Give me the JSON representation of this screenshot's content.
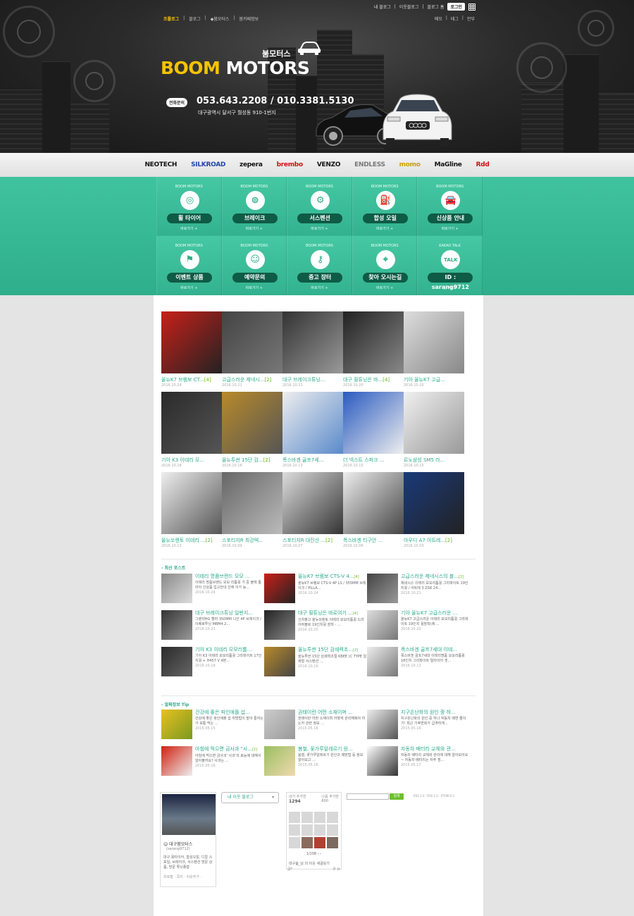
{
  "header": {
    "top_links": [
      "내 블로그",
      "이웃블로그",
      "블로그 홈"
    ],
    "login": "로그인",
    "nav": [
      "프롤로그",
      "블로그",
      "◆붐모터스",
      "붐카페정보"
    ],
    "nav_active": 0,
    "sub_links": [
      "메모",
      "태그",
      "안부"
    ],
    "logo_kor": "붐모터스",
    "logo_boom": "BOOM",
    "logo_motors": "MOTORS",
    "tel_label": "전화문의",
    "tel": "053.643.2208 / 010.3381.5130",
    "address": "대구광역시 달서구 월성동 910-1번지"
  },
  "brands": [
    {
      "name": "NEOTECH",
      "color": "#111111"
    },
    {
      "name": "SILKROAD",
      "color": "#2244aa"
    },
    {
      "name": "zepera",
      "color": "#111111"
    },
    {
      "name": "brembo",
      "color": "#cc1111"
    },
    {
      "name": "VENZO",
      "color": "#111111"
    },
    {
      "name": "ENDLESS",
      "color": "#777777"
    },
    {
      "name": "momo",
      "color": "#c8a000"
    },
    {
      "name": "MaGline",
      "color": "#111111"
    },
    {
      "name": "Rdd",
      "color": "#cc1111"
    }
  ],
  "menu": {
    "row1": [
      {
        "sub": "BOOM MOTORS",
        "label": "휠 타이어",
        "more": "바로가기 +",
        "icon": "wheel-icon",
        "glyph": "◎"
      },
      {
        "sub": "BOOM MOTORS",
        "label": "브레이크",
        "more": "바로가기 +",
        "icon": "brake-disc-icon",
        "glyph": "⊚"
      },
      {
        "sub": "BOOM MOTORS",
        "label": "서스펜션",
        "more": "바로가기 +",
        "icon": "suspension-icon",
        "glyph": "⚙"
      },
      {
        "sub": "BOOM MOTORS",
        "label": "합성 오일",
        "more": "바로가기 +",
        "icon": "oil-can-icon",
        "glyph": "⛽"
      },
      {
        "sub": "BOOM MOTORS",
        "label": "신상품 안내",
        "more": "바로가기 +",
        "icon": "car-lift-icon",
        "glyph": "🚘"
      }
    ],
    "row2": [
      {
        "sub": "BOOM MOTORS",
        "label": "이벤트 상품",
        "more": "바로가기 +",
        "icon": "checkered-flag-icon",
        "glyph": "⚑"
      },
      {
        "sub": "BOOM MOTORS",
        "label": "예약문의",
        "more": "바로가기 +",
        "icon": "chat-person-icon",
        "glyph": "☺"
      },
      {
        "sub": "BOOM MOTORS",
        "label": "중고 장터",
        "more": "바로가기 +",
        "icon": "car-key-icon",
        "glyph": "⚷"
      },
      {
        "sub": "BOOM MOTORS",
        "label": "찾아 오시는길",
        "more": "바로가기 +",
        "icon": "location-pin-icon",
        "glyph": "⌖"
      },
      {
        "sub": "KAKAO TALK",
        "label": "ID : sarang9712",
        "more": "친구추가",
        "icon": "kakao-talk-icon",
        "glyph": "TALK"
      }
    ]
  },
  "thumbs": [
    {
      "title": "올뉴K7 브렘보 CT...",
      "count": "[4]",
      "date": "2016.10.24",
      "c1": "#c8201a",
      "c2": "#222222"
    },
    {
      "title": "고급스러운 제네시...",
      "count": "[2]",
      "date": "2016.10.21",
      "c1": "#444444",
      "c2": "#777777"
    },
    {
      "title": "대구 브레이크튜닝...",
      "count": "",
      "date": "2016.10.21",
      "c1": "#333333",
      "c2": "#999999"
    },
    {
      "title": "대구 휠튜닝은 바...",
      "count": "[4]",
      "date": "2016.10.20",
      "c1": "#222222",
      "c2": "#888888"
    },
    {
      "title": "기아 올뉴K7 고급...",
      "count": "",
      "date": "2016.10.20",
      "c1": "#dddddd",
      "c2": "#888888"
    },
    {
      "title": "기아 K3 이테리 모...",
      "count": "",
      "date": "2016.10.18",
      "c1": "#2a2a2a",
      "c2": "#555555"
    },
    {
      "title": "올뉴투싼 15단 감...",
      "count": "[2]",
      "date": "2016.10.16",
      "c1": "#b88a2a",
      "c2": "#555555"
    },
    {
      "title": "폭스바겐 골프7세...",
      "count": "",
      "date": "2016.10.13",
      "c1": "#eeeeee",
      "c2": "#5a8acb"
    },
    {
      "title": "더 넥스트 스파크 ...",
      "count": "",
      "date": "2016.10.15",
      "c1": "#2a5ac0",
      "c2": "#eeeeee"
    },
    {
      "title": "르노삼성 SM5 라...",
      "count": "",
      "date": "2016.10.15",
      "c1": "#f0f0f0",
      "c2": "#999999"
    },
    {
      "title": "올뉴쏘렌토 이테리 ...",
      "count": "[2]",
      "date": "2016.10.13",
      "c1": "#eeeeee",
      "c2": "#555555"
    },
    {
      "title": "스포티지R 최강텍...",
      "count": "",
      "date": "2016.10.09",
      "c1": "#666666",
      "c2": "#bbbbbb"
    },
    {
      "title": "스포티지R 대진산 ...",
      "count": "[2]",
      "date": "2016.10.07",
      "c1": "#dddddd",
      "c2": "#333333"
    },
    {
      "title": "폭스바겐 티구안 ...",
      "count": "",
      "date": "2016.10.06",
      "c1": "#eeeeee",
      "c2": "#444444"
    },
    {
      "title": "아우디 A7 아트레...",
      "count": "[2]",
      "date": "2016.10.03",
      "c1": "#1a3a7a",
      "c2": "#222222"
    }
  ],
  "recent": {
    "title": "- 최신 포스트",
    "posts": [
      {
        "title": "이테리 명품브랜드 모모 ...",
        "count": "",
        "desc": "이테리 명품브랜드 모모 리튬휠 가 중 블랙 톱라이 신상품 입고안내 산에 이가 능...",
        "date": "2016.10.24",
        "c1": "#888888",
        "c2": "#dddddd"
      },
      {
        "title": "올뉴K7 브렘보 CTS-V 4...",
        "count": "[4]",
        "desc": "올뉴K7 브렘보 CTS-V 4P LS / 355MM 브레이크 / PILLA...",
        "date": "2016.10.24",
        "c1": "#c8201a",
        "c2": "#222222"
      },
      {
        "title": "고급스러운 제네시스의 블...",
        "count": "[2]",
        "desc": "제네시스 이테리 모모리튬휠 그라파이트 19인치휠 / 아트레 3 ZSR 24...",
        "date": "2016.10.21",
        "c1": "#444444",
        "c2": "#999999"
      },
      {
        "title": "대구 브레이크튜닝 일번지...",
        "count": "",
        "desc": "그랜저HG 헬라 350MM 나선 4P 브레이크 / 이베로투닝 M8M4 2...",
        "date": "2016.10.21",
        "c1": "#333333",
        "c2": "#999999"
      },
      {
        "title": "대구 휠튜닝은 바로여기 ...",
        "count": "[4]",
        "desc": "신차출고 올뉴쏘렌토 이테리 모모리튬휠 드라이버블로 19인치휠 장착 - ...",
        "date": "2016.10.20",
        "c1": "#222222",
        "c2": "#888888"
      },
      {
        "title": "기아 올뉴K7 고급스러운 ...",
        "count": "",
        "desc": "올뉴K7 고급스러운 이테리 모모리튬휠 그라파이트 19인치 휠장착(제 ...",
        "date": "2016.10.20",
        "c1": "#dddddd",
        "c2": "#777777"
      },
      {
        "title": "기아 K3 이테리 모모리튬...",
        "count": "",
        "desc": "기아 K3 이테리 모모리튬휠 그라파이트 17인치휠 + H457 V 4본...",
        "date": "2016.10.18",
        "c1": "#2a2a2a",
        "c2": "#666666"
      },
      {
        "title": "올뉴투싼 15단 감쇄력조...",
        "count": "[2]",
        "desc": "올뉴투싼 15단 감쇄력조절 KBEE (C TYPE 일체형 서스펜션 ...",
        "date": "2016.10.16",
        "c1": "#b88a2a",
        "c2": "#444444"
      },
      {
        "title": "폭스바겐 골프7세대 이테...",
        "count": "",
        "desc": "폭스바겐 골프7세대 이테리명품 모모리튬휠 18인치 그라파이트 틸타이어 셋...",
        "date": "2016.10.13",
        "c1": "#eeeeee",
        "c2": "#777777"
      }
    ]
  },
  "tips": {
    "title": "- 알짜정보 Tip",
    "posts": [
      {
        "title": "건강에 좋은 파인애플 섭...",
        "count": "",
        "desc": "건강에 좋은 파인애플 섭 취방법이 발아 통하는가 보통 먹는 ...",
        "date": "2015.05.15",
        "c1": "#e8c020",
        "c2": "#7a9a20"
      },
      {
        "title": "권태이란 어떤 소재이며 ...",
        "count": "",
        "desc": "권태이란 어떤 소재이며 어떻게 관리해줘야 하는지 관련 정보 ...",
        "date": "2015.05.16",
        "c1": "#cccccc",
        "c2": "#999999"
      },
      {
        "title": "지구온난화의 원인 중 하...",
        "count": "",
        "desc": "지구온난화의 원인 중 하나 자동차 매연 줄이기! 최근 기후변화가 급격하게...",
        "date": "2015.05.16",
        "c1": "#eeeeee",
        "c2": "#555555"
      },
      {
        "title": "아침에 먹으면 금사과 \"사...",
        "count": "[2]",
        "desc": "아침에 먹으면 금사과 '사과'의 효능에 대해서 알아볼까요? 사과는 ...",
        "date": "2015.05.16",
        "c1": "#d02010",
        "c2": "#eeeeee"
      },
      {
        "title": "봄철, 꽃가루알레르기 원...",
        "count": "",
        "desc": "봄철, 꽃가루알레르기 원인과 예방법 등 정보 알아보고 ...",
        "date": "2015.05.16",
        "c1": "#9ac060",
        "c2": "#f0d8b0"
      },
      {
        "title": "자동차 배터리 교체와 관...",
        "count": "",
        "desc": "자동차 배터리 교체와 관리에 대해 알아보아요 ~ 자동차 배터리는 자주 점...",
        "date": "2015.05.17",
        "c1": "#ffffff",
        "c2": "#333333"
      }
    ]
  },
  "profile": {
    "name": "대구붐모터스",
    "id": "(sarang9712)",
    "desc": "대구 휠타이어, 합성오일, 디칼 스포일, 브레이크, 서스펜션 방문 상품, 방문 튜닝종합",
    "links": "프로필 · 쪽지 · 이웃추가 ·"
  },
  "widgets": {
    "dropdown": "내 이웃 블로그",
    "neighbor_header_left": "내가 추가한",
    "neighbor_count": "1294",
    "neighbor_header_right": "나를 추가한",
    "neighbor_count2": "800",
    "pager": "1/108",
    "neighbor_foot": "대구붐_님 의 이웃 새글보기",
    "bottom_left": "글*",
    "bottom_right": "우 쓰",
    "search_btn": "검색",
    "rss": "RSS 2.0 · RSS 1.0 · ATOM 0.3"
  }
}
